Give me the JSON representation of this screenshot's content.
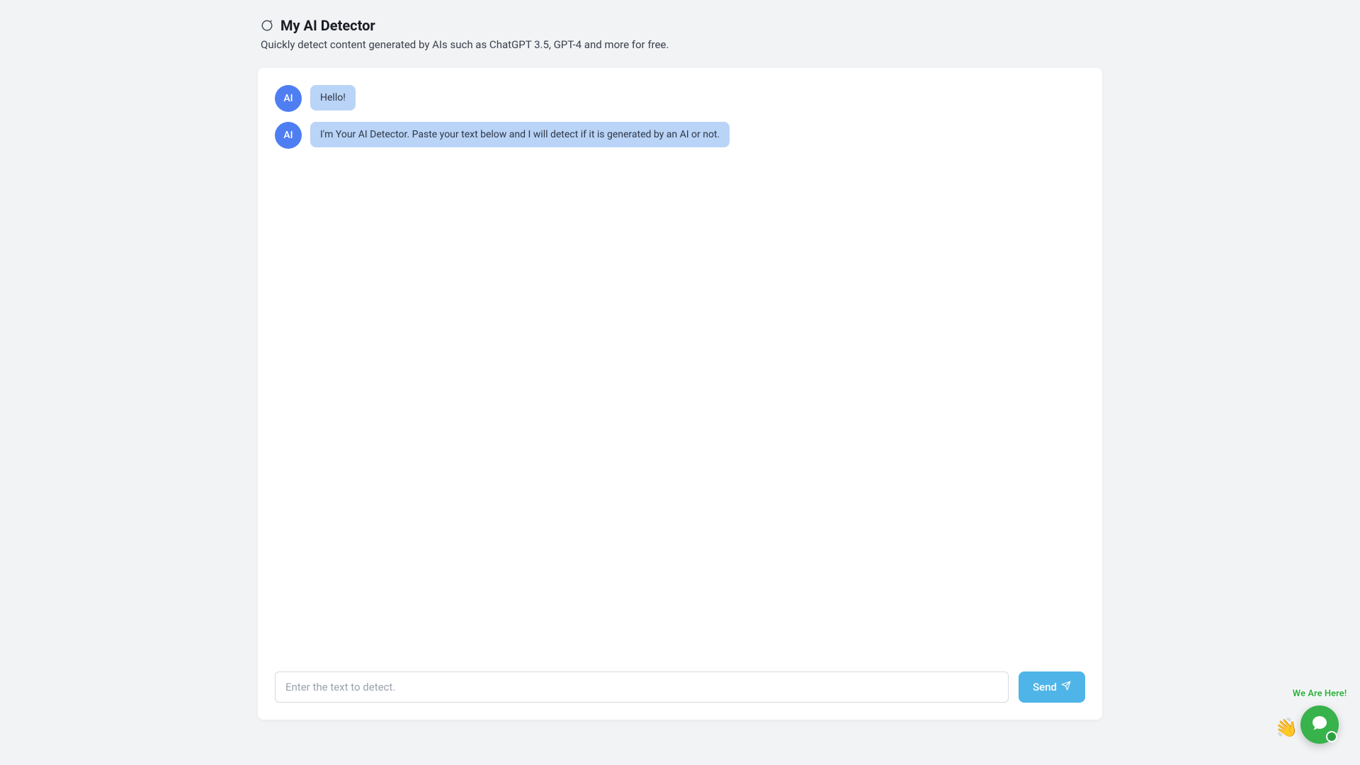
{
  "header": {
    "title": "My AI Detector",
    "subtitle": "Quickly detect content generated by AIs such as ChatGPT 3.5, GPT-4 and more for free."
  },
  "messages": [
    {
      "avatar": "AI",
      "text": "Hello!"
    },
    {
      "avatar": "AI",
      "text": "I'm Your AI Detector. Paste your text below and I will detect if it is generated by an AI or not."
    }
  ],
  "input": {
    "placeholder": "Enter the text to detect.",
    "value": ""
  },
  "send_button_label": "Send",
  "chat_widget": {
    "badge": "We Are Here!"
  }
}
